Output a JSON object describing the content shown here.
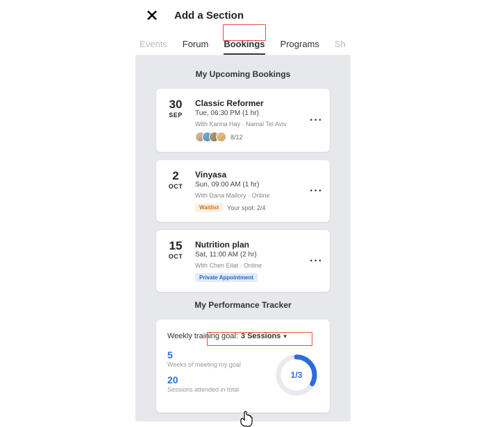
{
  "header": {
    "title": "Add a Section"
  },
  "tabs": {
    "events": "Events",
    "forum": "Forum",
    "bookings": "Bookings",
    "programs": "Programs",
    "shop": "Sh"
  },
  "sections": {
    "upcoming_title": "My Upcoming Bookings",
    "perf_title": "My Performance Tracker"
  },
  "bookings": [
    {
      "day": "30",
      "mon": "SEP",
      "title": "Classic Reformer",
      "time": "Tue, 06:30 PM (1 hr)",
      "meta": "With Karina Hay · Namal Tel Aviv",
      "count": "8/12"
    },
    {
      "day": "2",
      "mon": "OCT",
      "title": "Vinyasa",
      "time": "Sun, 09:00 AM (1 hr)",
      "meta": "With Dana Mallory · Online",
      "chip": "Waitlist",
      "spot": "Your spot: 2/4"
    },
    {
      "day": "15",
      "mon": "OCT",
      "title": "Nutrition plan",
      "time": "Sat, 11:00 AM (2 hr)",
      "meta": "With Chen Eilat · Online",
      "chip": "Private Appointment"
    }
  ],
  "perf": {
    "goal_prefix": "Weekly training goal:",
    "goal_value": "3 Sessions",
    "weeks_num": "5",
    "weeks_lbl": "Weeks of meeting my goal",
    "sessions_num": "20",
    "sessions_lbl": "Sessions attended in total",
    "ring_label": "1/3"
  }
}
